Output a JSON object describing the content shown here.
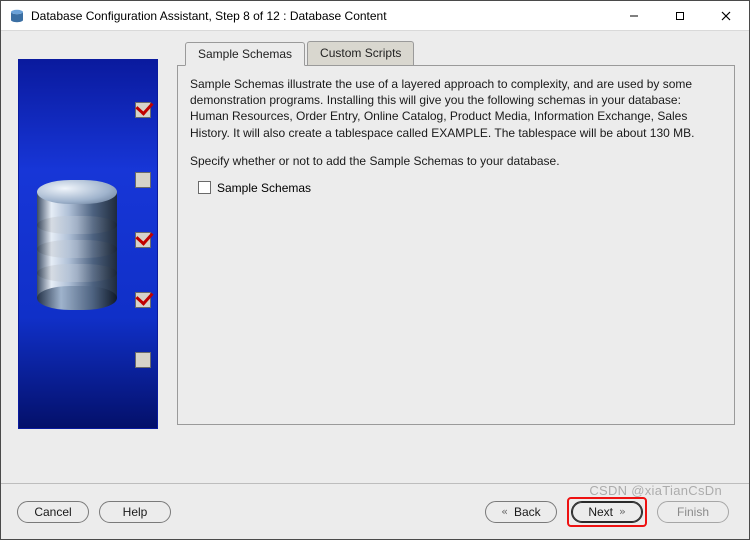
{
  "window": {
    "title": "Database Configuration Assistant, Step 8 of 12 : Database Content"
  },
  "tabs": {
    "sample_schemas": "Sample Schemas",
    "custom_scripts": "Custom Scripts"
  },
  "body": {
    "description": "Sample Schemas illustrate the use of a layered approach to complexity, and are used by some demonstration programs. Installing this will give you the following schemas in your database: Human Resources, Order Entry, Online Catalog, Product Media, Information Exchange, Sales History. It will also create a tablespace called EXAMPLE. The tablespace will be about 130 MB.",
    "prompt": "Specify whether or not to add the Sample Schemas to your database.",
    "checkbox_label": "Sample Schemas",
    "checkbox_checked": false
  },
  "side_steps": [
    {
      "checked": true
    },
    {
      "checked": false
    },
    {
      "checked": true
    },
    {
      "checked": true
    },
    {
      "checked": false
    }
  ],
  "footer": {
    "cancel": "Cancel",
    "help": "Help",
    "back": "Back",
    "next": "Next",
    "finish": "Finish"
  },
  "watermark": "CSDN @xiaTianCsDn"
}
